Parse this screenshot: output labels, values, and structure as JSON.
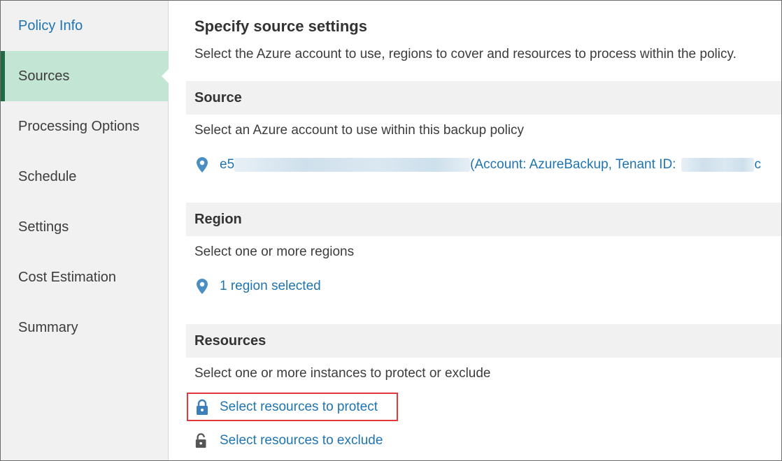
{
  "sidebar": {
    "items": [
      {
        "label": "Policy Info"
      },
      {
        "label": "Sources"
      },
      {
        "label": "Processing Options"
      },
      {
        "label": "Schedule"
      },
      {
        "label": "Settings"
      },
      {
        "label": "Cost Estimation"
      },
      {
        "label": "Summary"
      }
    ],
    "active": "Sources"
  },
  "main": {
    "title": "Specify source settings",
    "description": "Select the Azure account to use, regions to cover and resources to process within the policy.",
    "source": {
      "header": "Source",
      "text": "Select an Azure account to use within this backup policy",
      "account_prefix": "e5",
      "account_details": "(Account: AzureBackup, Tenant ID:",
      "account_suffix": "c",
      "icon": "location-pin-icon"
    },
    "region": {
      "header": "Region",
      "text": "Select one or more regions",
      "link": "1 region selected",
      "icon": "location-pin-icon"
    },
    "resources": {
      "header": "Resources",
      "text": "Select one or more instances to protect or exclude",
      "protect_link": "Select resources to protect",
      "exclude_link": "Select resources to exclude",
      "protect_icon": "lock-icon",
      "exclude_icon": "unlock-icon"
    }
  },
  "colors": {
    "link": "#1f74b2",
    "active_bg": "#c3e6d4",
    "active_bar": "#1e6b46",
    "highlight": "#e0393e"
  }
}
